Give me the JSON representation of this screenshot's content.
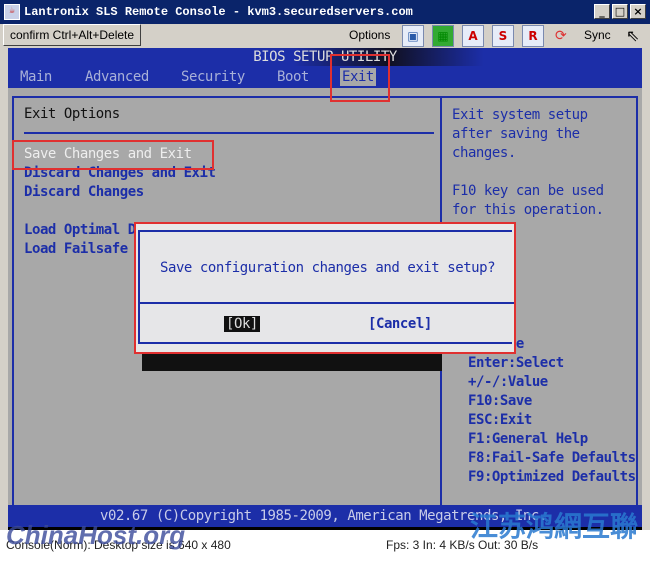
{
  "window": {
    "title": "Lantronix SLS Remote Console - kvm3.securedservers.com",
    "minimize": "_",
    "maximize": "□",
    "close": "×"
  },
  "toolbar": {
    "confirm": "confirm Ctrl+Alt+Delete",
    "options": "Options",
    "icons": [
      "save-icon",
      "monitor-icon",
      "A",
      "S",
      "R"
    ],
    "sync": "Sync"
  },
  "bios": {
    "title": "BIOS SETUP UTILITY",
    "tabs": [
      "Main",
      "Advanced",
      "Security",
      "Boot",
      "Exit"
    ],
    "active_tab": "Exit",
    "section": "Exit Options",
    "items": [
      "Save Changes and Exit",
      "Discard Changes and Exit",
      "Discard Changes",
      "Load Optimal Defaults",
      "Load Failsafe Defaults"
    ],
    "help": [
      "Exit system setup",
      "after saving the",
      "changes.",
      "",
      "F10 key can be used",
      "for this operation."
    ],
    "keys": [
      "↑↓:Move",
      "Enter:Select",
      "+/-/:Value",
      "F10:Save",
      "ESC:Exit",
      "F1:General Help",
      "F8:Fail-Safe Defaults",
      "F9:Optimized Defaults"
    ],
    "footer": "v02.67 (C)Copyright 1985-2009, American Megatrends, Inc.",
    "dialog": {
      "message": "Save configuration changes and exit setup?",
      "ok": "[Ok]",
      "cancel": "[Cancel]"
    }
  },
  "status": {
    "left": "Console(Norm): Desktop size is 640 x 480",
    "right": "Fps: 3 In: 4 KB/s Out: 30 B/s"
  },
  "watermarks": [
    "ChinaHost.org",
    "江苏鸿網互聯"
  ],
  "colors": {
    "bios_blue": "#1c2ea8",
    "bios_gray": "#a8a8a8",
    "highlight_red": "#e03030"
  }
}
